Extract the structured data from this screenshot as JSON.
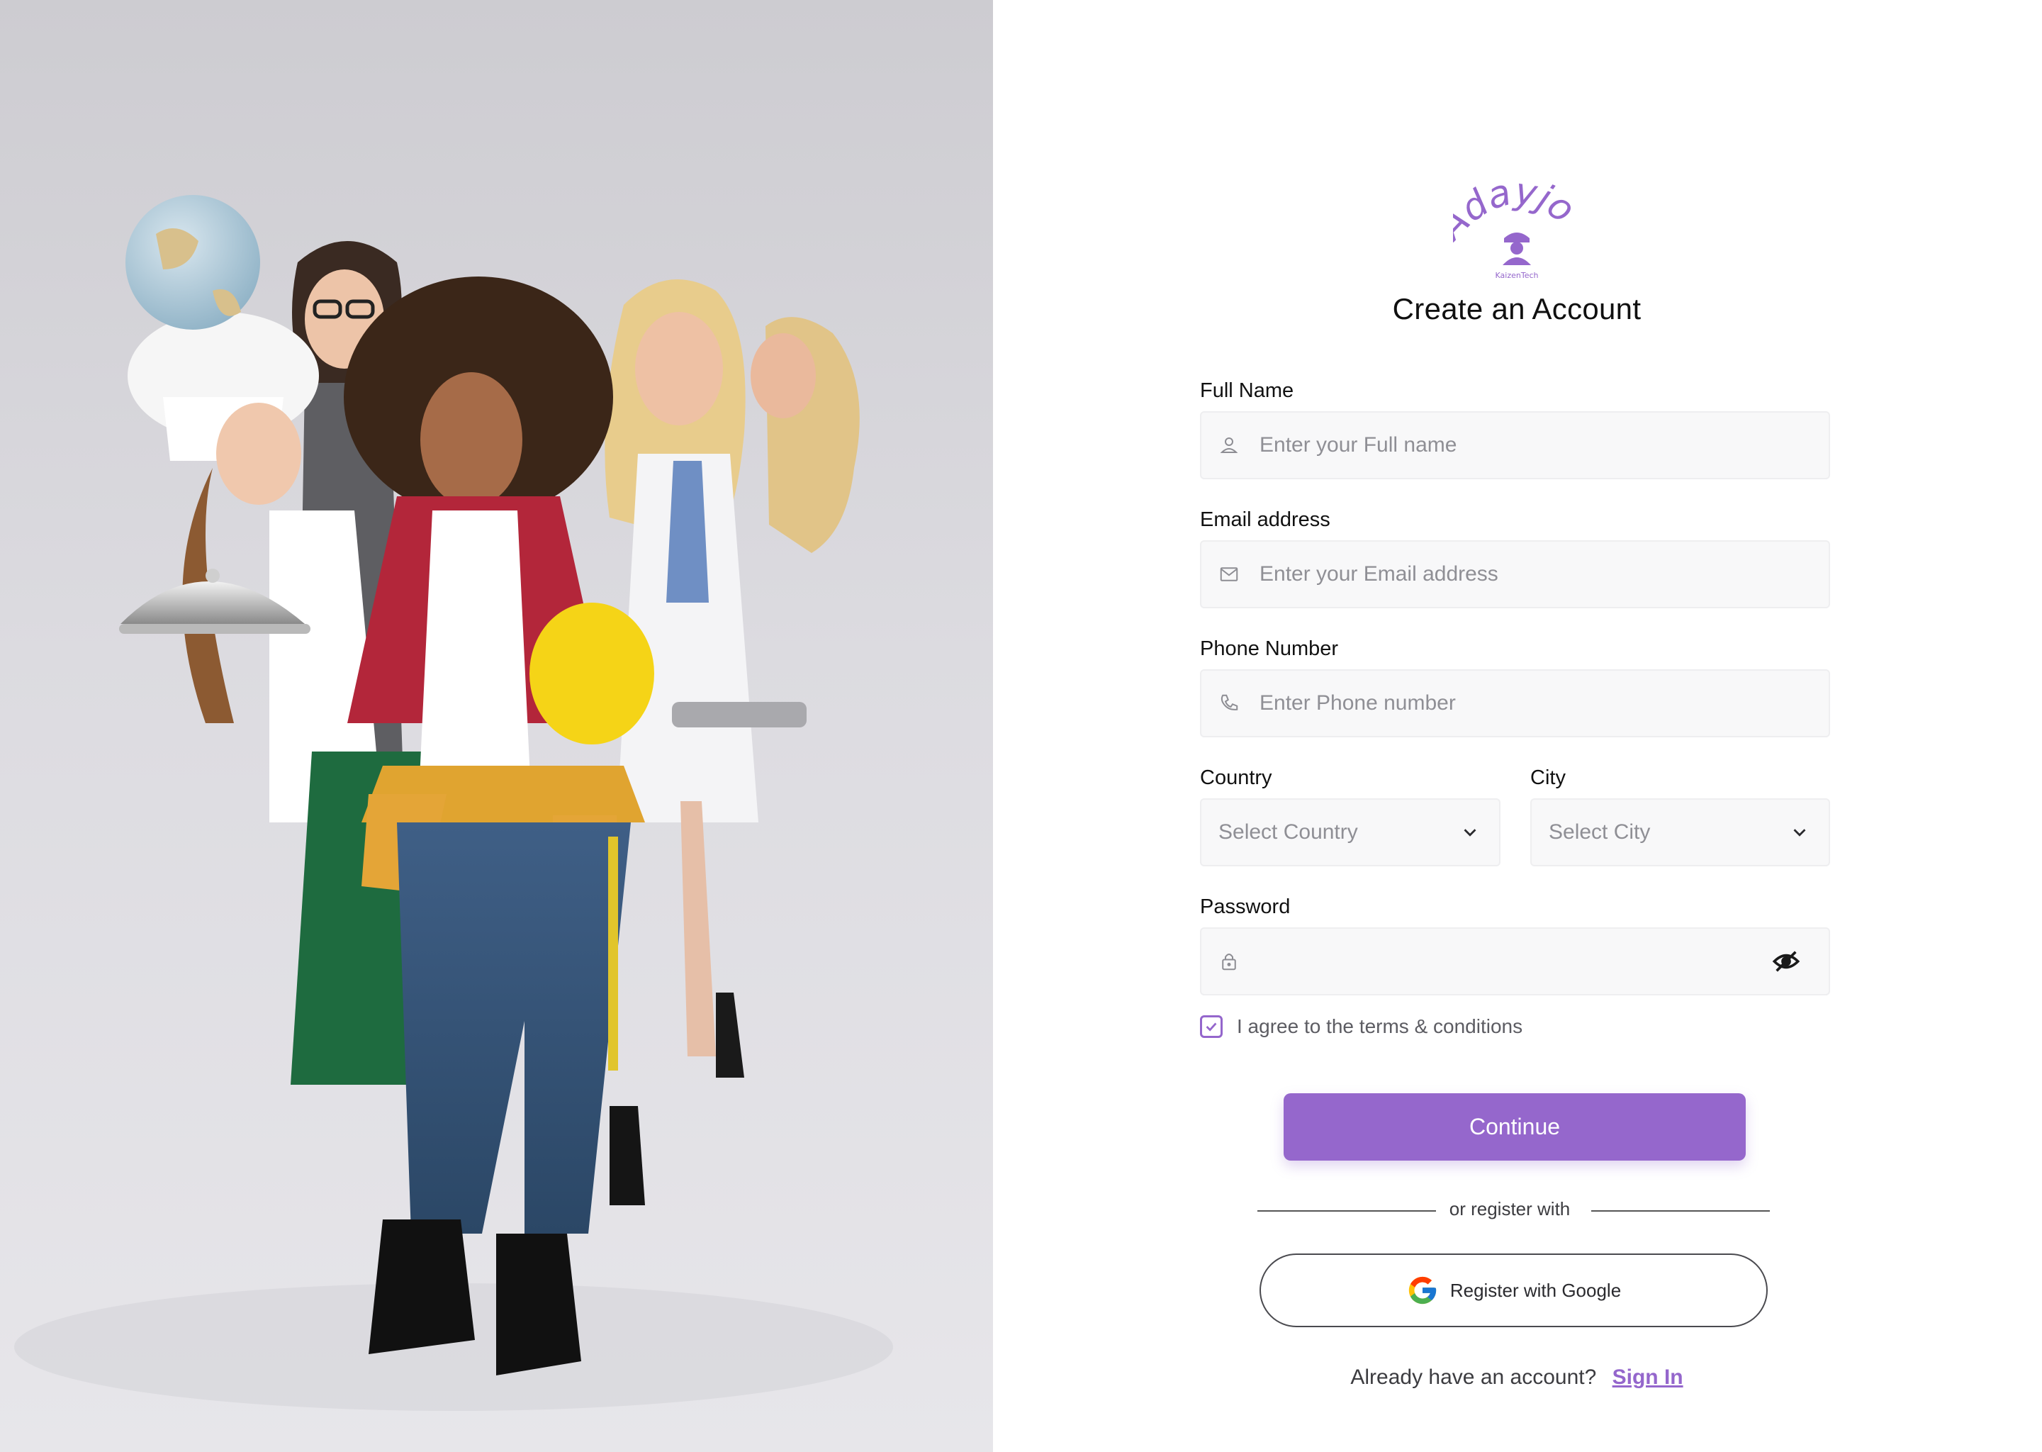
{
  "brand": {
    "logo_text": "Adayjob",
    "logo_subtext": "KaizenTech",
    "accent_color": "#9567cc"
  },
  "hero_image": {
    "subject": "group-of-professional-women-photo"
  },
  "form": {
    "title": "Create an Account",
    "full_name": {
      "label": "Full Name",
      "placeholder": "Enter your Full name",
      "icon": "user-icon"
    },
    "email": {
      "label": "Email address",
      "placeholder": "Enter your Email address",
      "icon": "mail-icon"
    },
    "phone": {
      "label": "Phone Number",
      "placeholder": "Enter Phone number",
      "icon": "phone-icon"
    },
    "country": {
      "label": "Country",
      "placeholder": "Select Country",
      "icon": "chevron-down-icon"
    },
    "city": {
      "label": "City",
      "placeholder": "Select City",
      "icon": "chevron-down-icon"
    },
    "password": {
      "label": "Password",
      "value": "",
      "icon": "lock-icon",
      "toggle_icon": "eye-off-icon"
    },
    "terms": {
      "label": "I agree to the terms & conditions",
      "checked": true
    },
    "continue_label": "Continue",
    "divider_text": "or register with",
    "google_label": "Register with Google",
    "signin_prompt": "Already have an account?",
    "signin_link": "Sign In"
  }
}
